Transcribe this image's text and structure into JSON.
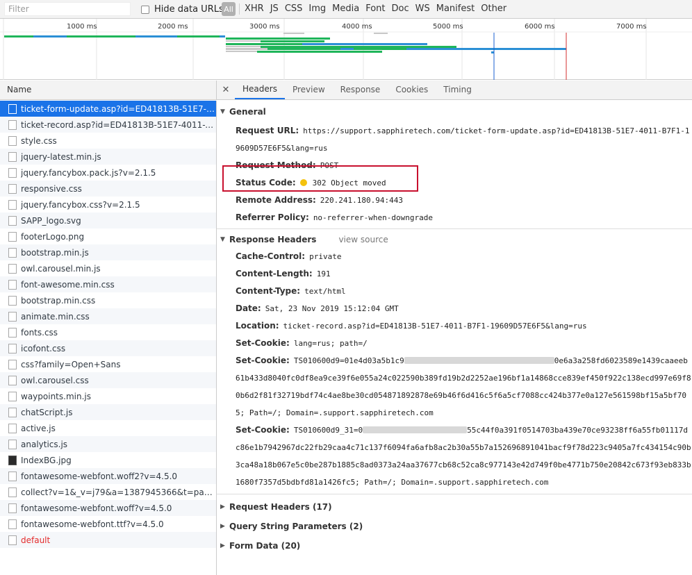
{
  "filterbar": {
    "filter_placeholder": "Filter",
    "hide_urls_label": "Hide data URLs",
    "all_label": "All",
    "types": [
      "XHR",
      "JS",
      "CSS",
      "Img",
      "Media",
      "Font",
      "Doc",
      "WS",
      "Manifest",
      "Other"
    ]
  },
  "overview": {
    "ticks": [
      "1000 ms",
      "2000 ms",
      "3000 ms",
      "4000 ms",
      "5000 ms",
      "6000 ms",
      "7000 ms"
    ],
    "colors": {
      "waiting": "#1fb55a",
      "download": "#2a8fd5",
      "stalled": "#c8c8c8",
      "dom": "#1a5fd0",
      "load": "#d32f2f"
    }
  },
  "list": {
    "header": "Name",
    "items": [
      {
        "label": "ticket-form-update.asp?id=ED41813B-51E7-4...",
        "selected": true
      },
      {
        "label": "ticket-record.asp?id=ED41813B-51E7-4011-B..."
      },
      {
        "label": "style.css"
      },
      {
        "label": "jquery-latest.min.js"
      },
      {
        "label": "jquery.fancybox.pack.js?v=2.1.5"
      },
      {
        "label": "responsive.css"
      },
      {
        "label": "jquery.fancybox.css?v=2.1.5"
      },
      {
        "label": "SAPP_logo.svg"
      },
      {
        "label": "footerLogo.png"
      },
      {
        "label": "bootstrap.min.js"
      },
      {
        "label": "owl.carousel.min.js"
      },
      {
        "label": "font-awesome.min.css"
      },
      {
        "label": "bootstrap.min.css"
      },
      {
        "label": "animate.min.css"
      },
      {
        "label": "fonts.css"
      },
      {
        "label": "icofont.css"
      },
      {
        "label": "css?family=Open+Sans"
      },
      {
        "label": "owl.carousel.css"
      },
      {
        "label": "waypoints.min.js"
      },
      {
        "label": "chatScript.js"
      },
      {
        "label": "active.js"
      },
      {
        "label": "analytics.js"
      },
      {
        "label": "IndexBG.jpg",
        "icon": "image"
      },
      {
        "label": "fontawesome-webfont.woff2?v=4.5.0"
      },
      {
        "label": "collect?v=1&_v=j79&a=1387945366&t=page..."
      },
      {
        "label": "fontawesome-webfont.woff?v=4.5.0"
      },
      {
        "label": "fontawesome-webfont.ttf?v=4.5.0"
      },
      {
        "label": "default",
        "error": true
      }
    ]
  },
  "tabs": {
    "close": "✕",
    "items": [
      "Headers",
      "Preview",
      "Response",
      "Cookies",
      "Timing"
    ],
    "active": "Headers"
  },
  "general": {
    "title": "General",
    "request_url_key": "Request URL:",
    "request_url_val": "https://support.sapphiretech.com/ticket-form-update.asp?id=ED41813B-51E7-4011-B7F1-19609D57E6F5&lang=rus",
    "request_method_key": "Request Method:",
    "request_method_val": "POST",
    "status_code_key": "Status Code:",
    "status_code_val": "302 Object moved",
    "remote_address_key": "Remote Address:",
    "remote_address_val": "220.241.180.94:443",
    "referrer_policy_key": "Referrer Policy:",
    "referrer_policy_val": "no-referrer-when-downgrade"
  },
  "response_headers": {
    "title": "Response Headers",
    "view_source": "view source",
    "rows": [
      {
        "key": "Cache-Control:",
        "val": "private"
      },
      {
        "key": "Content-Length:",
        "val": "191"
      },
      {
        "key": "Content-Type:",
        "val": "text/html"
      },
      {
        "key": "Date:",
        "val": "Sat, 23 Nov 2019 15:12:04 GMT"
      },
      {
        "key": "Location:",
        "val": "ticket-record.asp?id=ED41813B-51E7-4011-B7F1-19609D57E6F5&lang=rus"
      },
      {
        "key": "Set-Cookie:",
        "val": "lang=rus; path=/"
      }
    ],
    "cookie1_key": "Set-Cookie:",
    "cookie1_a": "TS010600d9=01e4d03a5b1c9",
    "cookie1_b": "0e6a3a258fd6023589e1439caaeeb61b433d8040fc0df8ea9ce39f6e055a24c022590b389fd19b2d2252ae196bf1a14868cce839ef450f922c138ecd997e69f80b6d2f81f32719bdf74c4ae8be30cd054871892878e69b46f6d416c5f6a5cf7088cc424b377e0a127e561598bf15a5bf705; Path=/; Domain=.support.sapphiretech.com",
    "cookie2_key": "Set-Cookie:",
    "cookie2_a": "TS010600d9_31=0",
    "cookie2_b": "55c44f0a391f0514703ba439e70ce93238ff6a55fb01117dc86e1b7942967dc22fb29caa4c71c137f6094fa6afb8ac2b30a55b7a152696891041bacf9f78d223c9405a7fc434154c90b3ca48a18b067e5c0be287b1885c8ad0373a24aa37677cb68c52ca8c977143e42d749f0be4771b750e20842c673f93eb833b1680f7357d5bdbfd81a1426fc5; Path=/; Domain=.support.sapphiretech.com"
  },
  "collapsed_sections": [
    {
      "label": "Request Headers (17)"
    },
    {
      "label": "Query String Parameters (2)"
    },
    {
      "label": "Form Data (20)"
    }
  ]
}
